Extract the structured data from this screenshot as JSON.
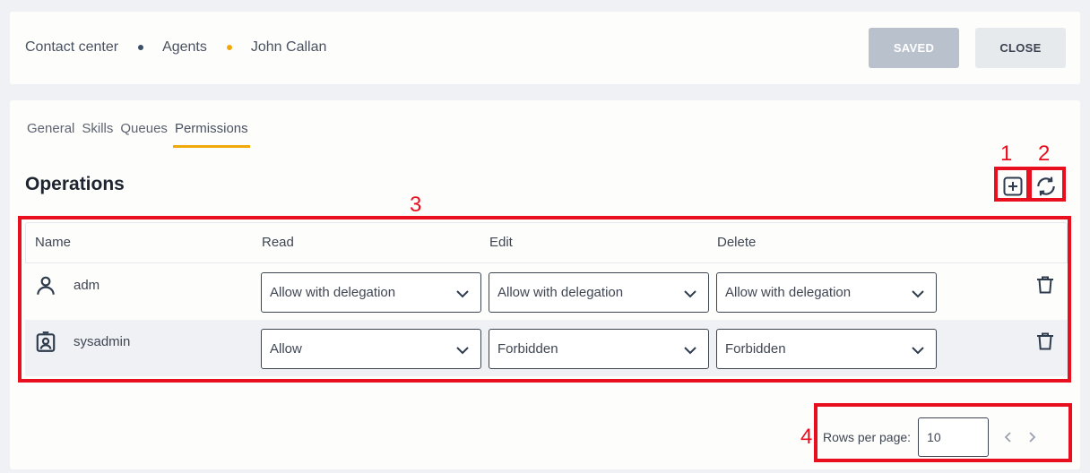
{
  "breadcrumb": [
    "Contact center",
    "Agents",
    "John Callan"
  ],
  "colors": {
    "accent": "#f1a90a",
    "navy": "#3b4e66",
    "annotation": "#e8101e",
    "saved_bg": "#b9c2cc"
  },
  "buttons": {
    "saved": "SAVED",
    "close": "CLOSE"
  },
  "tabs": [
    {
      "label": "General",
      "active": false
    },
    {
      "label": "Skills",
      "active": false
    },
    {
      "label": "Queues",
      "active": false
    },
    {
      "label": "Permissions",
      "active": true
    }
  ],
  "section": {
    "title": "Operations"
  },
  "icons": {
    "add": "plus-square-icon",
    "refresh": "refresh-icon",
    "delete": "trash-icon"
  },
  "table": {
    "headers": [
      "Name",
      "Read",
      "Edit",
      "Delete"
    ],
    "rows": [
      {
        "name": "adm",
        "icon": "user-icon",
        "read": "Allow with delegation",
        "edit": "Allow with delegation",
        "delete": "Allow with delegation"
      },
      {
        "name": "sysadmin",
        "icon": "user-badge-icon",
        "read": "Allow",
        "edit": "Forbidden",
        "delete": "Forbidden"
      }
    ]
  },
  "pagination": {
    "label": "Rows per page:",
    "value": "10"
  },
  "annotations": [
    "1",
    "2",
    "3",
    "4"
  ]
}
